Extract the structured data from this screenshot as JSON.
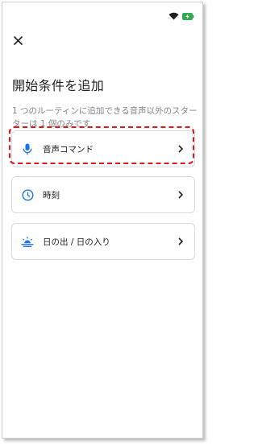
{
  "header": {
    "title": "開始条件を追加",
    "description": "1 つのルーティンに追加できる音声以外のスターターは 1 個のみです"
  },
  "starters": [
    {
      "label": "音声コマンド",
      "icon": "mic-icon"
    },
    {
      "label": "時刻",
      "icon": "clock-icon"
    },
    {
      "label": "日の出 / 日の入り",
      "icon": "sunrise-icon"
    }
  ],
  "colors": {
    "accent": "#1a73e8",
    "highlight": "#e0161b",
    "battery": "#34a853"
  }
}
